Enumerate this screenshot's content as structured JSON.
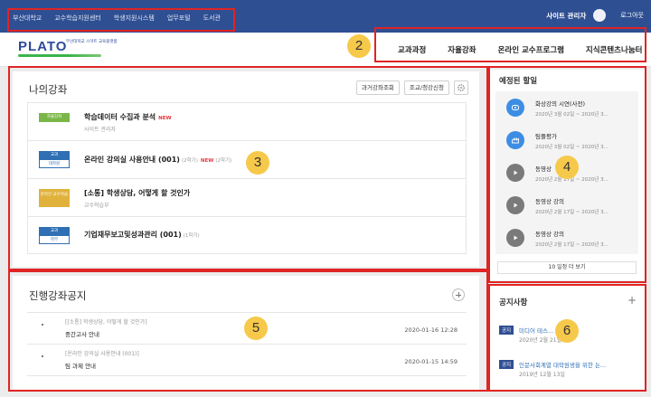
{
  "topbar": {
    "links": [
      "부산대학교",
      "교수학습지원센터",
      "학생지원시스템",
      "업무포털",
      "도서관"
    ],
    "user": "사이트 관리자",
    "logout": "로그아웃"
  },
  "header": {
    "logo": "PLATO",
    "logo_sub": "부산대학교 스마트 교육플랫폼",
    "nav": [
      "교과과정",
      "자율강좌",
      "온라인 교수프로그램",
      "지식콘텐츠나눔터"
    ]
  },
  "my_courses": {
    "title": "나의강좌",
    "buttons": [
      "과거강좌조회",
      "조교/청강신청"
    ],
    "items": [
      {
        "badge_top": "자율강좌",
        "badge_bottom": "",
        "badge_color": "#7ab648",
        "title": "학습데이터 수집과 분석",
        "term": "",
        "new": "NEW",
        "term2": "",
        "sub": "사이트 관리자"
      },
      {
        "badge_top": "교과",
        "badge_bottom": "대학원",
        "badge_color": "#2f6fb3",
        "title": "온라인 강의실 사용안내 (001)",
        "term": "(2학기)",
        "new": "NEW",
        "term2": "(2학기)",
        "sub": ""
      },
      {
        "badge_top": "온라인 교수학습",
        "badge_bottom": "",
        "badge_color": "#e0b23c",
        "title": "[소통] 학생상담, 어떻게 할 것인가",
        "term": "",
        "new": "",
        "term2": "",
        "sub": "교수학습부"
      },
      {
        "badge_top": "교과",
        "badge_bottom": "학부",
        "badge_color": "#2f6fb3",
        "title": "기업재무보고및성과관리 (001)",
        "term": "(1학기)",
        "new": "",
        "term2": "",
        "sub": ""
      }
    ]
  },
  "course_notices": {
    "title": "진행강좌공지",
    "items": [
      {
        "course": "[[소통] 학생상담, 어떻게 할 것인가]",
        "title": "중간고사 안내",
        "date": "2020-01-16 12:28"
      },
      {
        "course": "[온라인 강의실 사용안내 (001)]",
        "title": "팀 과제 안내",
        "date": "2020-01-15 14:59"
      }
    ]
  },
  "upcoming": {
    "title": "예정된 할일",
    "items": [
      {
        "title": "화상강의 시연(사전)",
        "date": "2020년 3월 02일 ~ 2020년 3...",
        "icon": "video-call-icon",
        "color": "#3d8ee3"
      },
      {
        "title": "팀플평가",
        "date": "2020년 3월 02일 ~ 2020년 3...",
        "icon": "team-icon",
        "color": "#3d8ee3"
      },
      {
        "title": "동영상",
        "date": "2020년 2월 17일 ~ 2020년 3...",
        "icon": "play-icon",
        "color": "#7a7a7a"
      },
      {
        "title": "동영상 강의",
        "date": "2020년 2월 17일 ~ 2020년 3...",
        "icon": "play-icon",
        "color": "#7a7a7a"
      },
      {
        "title": "동영상 강의",
        "date": "2020년 2월 17일 ~ 2020년 3...",
        "icon": "play-icon",
        "color": "#7a7a7a"
      }
    ],
    "more": "10 일정 더 보기"
  },
  "board": {
    "title": "공지사항",
    "items": [
      {
        "tag": "공지",
        "title": "미디어 테스...",
        "date": "2020년 2월 21일"
      },
      {
        "tag": "공지",
        "title": "인문사회계열 대학원생을 위한 논...",
        "date": "2019년 12월 13일"
      }
    ]
  },
  "annotations": [
    "1",
    "2",
    "3",
    "4",
    "5",
    "6"
  ]
}
